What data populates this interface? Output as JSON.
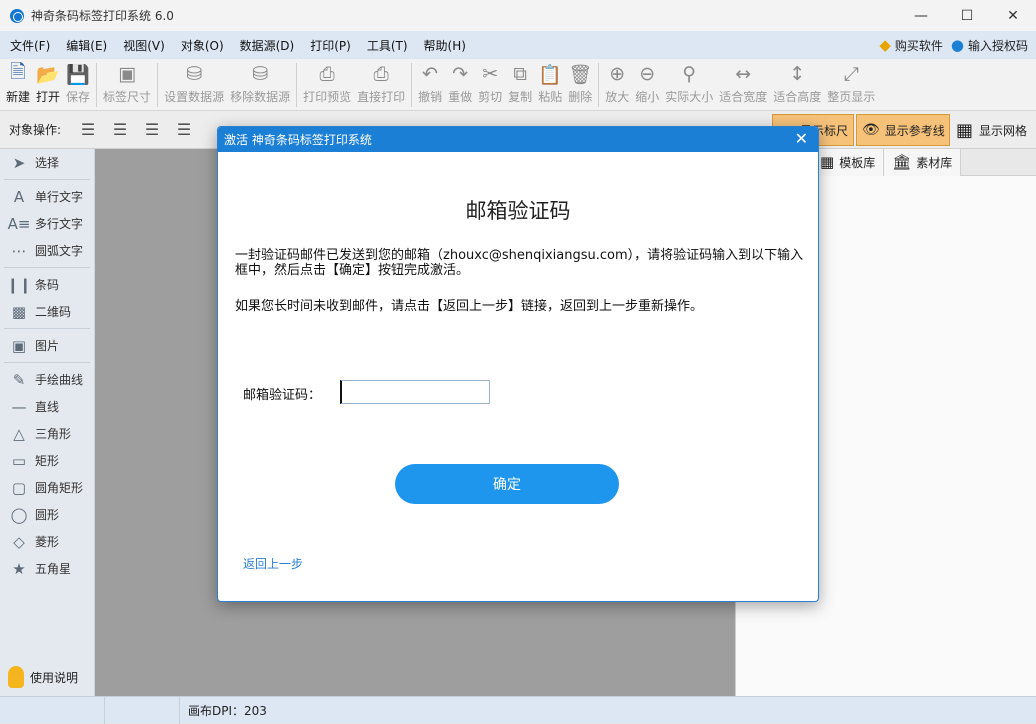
{
  "window": {
    "title": "神奇条码标签打印系统 6.0"
  },
  "menu": {
    "items": [
      "文件(F)",
      "编辑(E)",
      "视图(V)",
      "对象(O)",
      "数据源(D)",
      "打印(P)",
      "工具(T)",
      "帮助(H)"
    ],
    "buy": "购买软件",
    "license": "输入授权码"
  },
  "toolbar": {
    "items": [
      {
        "label": "新建",
        "icon": "new-file-icon",
        "enabled": true
      },
      {
        "label": "打开",
        "icon": "open-icon",
        "enabled": true
      },
      {
        "label": "保存",
        "icon": "save-icon",
        "enabled": false
      },
      {
        "label": "标签尺寸",
        "icon": "label-size-icon",
        "enabled": false
      },
      {
        "label": "设置数据源",
        "icon": "database-icon",
        "enabled": false
      },
      {
        "label": "移除数据源",
        "icon": "database-remove-icon",
        "enabled": false
      },
      {
        "label": "打印预览",
        "icon": "print-preview-icon",
        "enabled": false
      },
      {
        "label": "直接打印",
        "icon": "print-icon",
        "enabled": false
      },
      {
        "label": "撤销",
        "icon": "undo-icon",
        "enabled": false
      },
      {
        "label": "重做",
        "icon": "redo-icon",
        "enabled": false
      },
      {
        "label": "剪切",
        "icon": "cut-icon",
        "enabled": false
      },
      {
        "label": "复制",
        "icon": "copy-icon",
        "enabled": false
      },
      {
        "label": "粘贴",
        "icon": "paste-icon",
        "enabled": false
      },
      {
        "label": "删除",
        "icon": "delete-icon",
        "enabled": false
      },
      {
        "label": "放大",
        "icon": "zoom-in-icon",
        "enabled": false
      },
      {
        "label": "缩小",
        "icon": "zoom-out-icon",
        "enabled": false
      },
      {
        "label": "实际大小",
        "icon": "actual-size-icon",
        "enabled": false
      },
      {
        "label": "适合宽度",
        "icon": "fit-width-icon",
        "enabled": false
      },
      {
        "label": "适合高度",
        "icon": "fit-height-icon",
        "enabled": false
      },
      {
        "label": "整页显示",
        "icon": "full-page-icon",
        "enabled": false
      }
    ]
  },
  "objbar": {
    "label": "对象操作:",
    "show_ruler": "显示标尺",
    "show_guides": "显示参考线",
    "show_grid": "显示网格"
  },
  "left_tools": [
    {
      "label": "选择",
      "icon": "pointer-icon"
    },
    {
      "label": "单行文字",
      "icon": "single-line-text-icon"
    },
    {
      "label": "多行文字",
      "icon": "multi-line-text-icon"
    },
    {
      "label": "圆弧文字",
      "icon": "arc-text-icon"
    },
    {
      "label": "条码",
      "icon": "barcode-icon"
    },
    {
      "label": "二维码",
      "icon": "qrcode-icon"
    },
    {
      "label": "图片",
      "icon": "image-icon"
    },
    {
      "label": "手绘曲线",
      "icon": "freehand-icon"
    },
    {
      "label": "直线",
      "icon": "line-icon"
    },
    {
      "label": "三角形",
      "icon": "triangle-icon"
    },
    {
      "label": "矩形",
      "icon": "rectangle-icon"
    },
    {
      "label": "圆角矩形",
      "icon": "rounded-rect-icon"
    },
    {
      "label": "圆形",
      "icon": "circle-icon"
    },
    {
      "label": "菱形",
      "icon": "diamond-icon"
    },
    {
      "label": "五角星",
      "icon": "star-icon"
    }
  ],
  "help": {
    "label": "使用说明"
  },
  "right_tabs": [
    {
      "label": "模板库",
      "icon": "template-icon"
    },
    {
      "label": "素材库",
      "icon": "library-icon"
    }
  ],
  "status": {
    "dpi": "画布DPI：203"
  },
  "dialog": {
    "title": "激活 神奇条码标签打印系统",
    "heading": "邮箱验证码",
    "message1": "一封验证码邮件已发送到您的邮箱（zhouxc@shenqixiangsu.com），请将验证码输入到以下输入框中，然后点击【确定】按钮完成激活。",
    "message2": "如果您长时间未收到邮件，请点击【返回上一步】链接，返回到上一步重新操作。",
    "code_label": "邮箱验证码：",
    "code_value": "",
    "confirm": "确定",
    "back": "返回上一步"
  },
  "colors": {
    "accent": "#1c7fd6",
    "button": "#1e96ee",
    "toggle_active": "#f6c27a"
  }
}
